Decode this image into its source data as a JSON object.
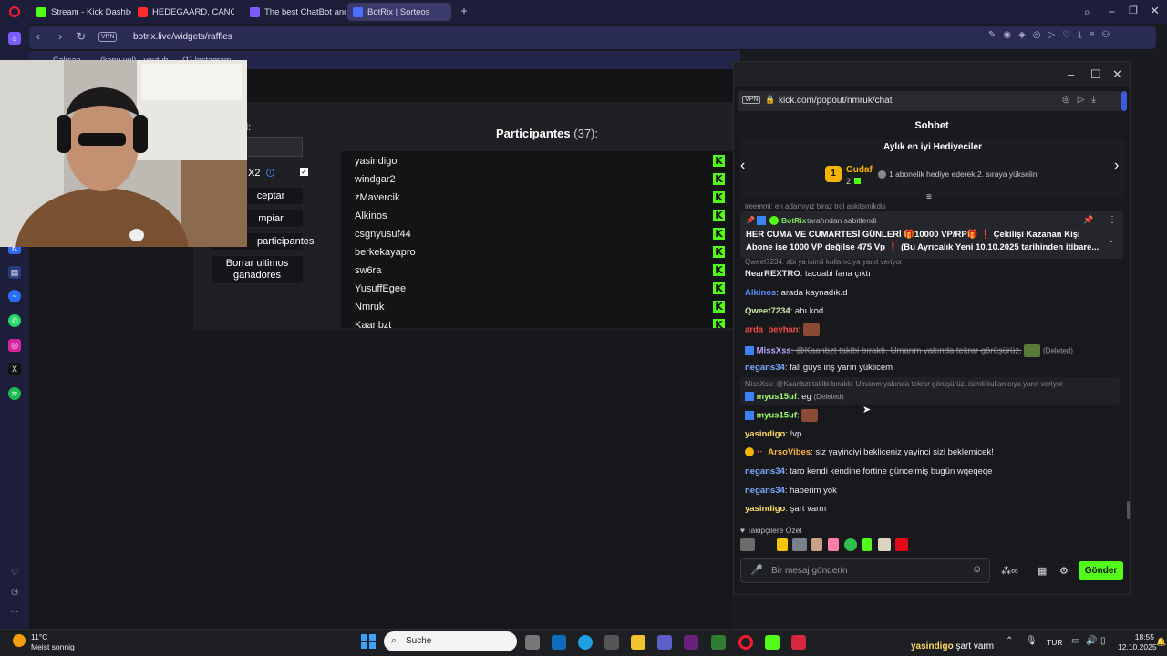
{
  "browser": {
    "tabs": [
      {
        "label": "Stream - Kick Dashboard",
        "color": "#53fc18"
      },
      {
        "label": "HEDEGAARD, CANCUN?, I",
        "color": "#ff2d2d"
      },
      {
        "label": "The best ChatBot and Wi",
        "color": "#7a5cff"
      },
      {
        "label": "BotRix | Sorteos",
        "color": "#4c6fff"
      }
    ],
    "new_tab": "+",
    "url": "botrix.live/widgets/raffles",
    "vpn": "VPN",
    "bookmarks": [
      "Çalışan",
      "(kopu yol) - youtub",
      "(1) Instagram"
    ]
  },
  "raffle": {
    "field_label": "d:",
    "x2_label": "X2",
    "buttons": [
      "ceptar",
      "mpiar",
      "participantes",
      "Borrar ultimos ganadores"
    ],
    "title": "Participantes",
    "count": "(37):",
    "participants": [
      "yasindigo",
      "windgar2",
      "zMavercik",
      "Alkinos",
      "csgnyusuf44",
      "berkekayapro",
      "sw6ra",
      "YusuffEgee",
      "Nmruk",
      "Kaanbzt"
    ]
  },
  "chat": {
    "url": "kick.com/popout/nmruk/chat",
    "vpn": "VPN",
    "title": "Sohbet",
    "gifter_heading": "Aylık en iyi Hediyeciler",
    "gifter_rank": "1",
    "gifter_name": "Gudaf",
    "gifter_count": "2",
    "gifter_note": "1 abonelik hediye ederek 2. sıraya yükselin",
    "partial_top": "ireemmi: en adamıyız biraz trol askitsmikdis",
    "pinned_by": "BotRix",
    "pinned_by_suffix": "tarafından sabitlendi",
    "pinned_text_1": "HER CUMA VE CUMARTESİ GÜNLERİ 🎁10000 VP/RP🎁 ❗ Çekilişi Kazanan Kişi",
    "pinned_text_2": "Abone ise 1000 VP değilse 475 Vp ❗ (Bu Ayrıcalık Yeni 10.10.2025 tarihinden itibare...",
    "reply_partial": "Qweet7234: abi ya isimli kullanıcıya yanıt veriyor",
    "messages": [
      {
        "user": "NearREXTRO",
        "color": "#e8e8e8",
        "text": ": tacoabi fana çıktı"
      },
      {
        "user": "Alkinos",
        "color": "#5b8dff",
        "text": ": arada kaynadık.d"
      },
      {
        "user": "Qweet7234",
        "color": "#cfe8a8",
        "text": ": abı kod"
      },
      {
        "user": "arda_beyhan",
        "color": "#ff4b4b",
        "text": ":"
      },
      {
        "user": "MissXss",
        "color": "#b9a6ff",
        "text": ": @Kaanbzt takibi bıraktı. Umarım yakında tekrar görüşürüz.",
        "tag": "(Deleted)"
      },
      {
        "user": "negans34",
        "color": "#7fa8ff",
        "text": ": fall guys inş yarın yüklicem"
      },
      {
        "user": "myus15uf",
        "color": "#9dff6d",
        "text": ": eg",
        "tag": "(Deleted)",
        "reply": "MissXss: @Kaanbzt takibi bıraktı. Umarım yakında tekrar görüşürüz. isimli kullanıcıya yanıt veriyor"
      },
      {
        "user": "myus15uf",
        "color": "#9dff6d",
        "text": ":"
      },
      {
        "user": "yasindigo",
        "color": "#ffd966",
        "text": ": !vp"
      },
      {
        "user": "ArsoVibes",
        "color": "#ffb640",
        "text": ": siz yayinciyi bekliceniz yayinci sizi beklemicek!"
      },
      {
        "user": "negans34",
        "color": "#7fa8ff",
        "text": ": taro kendi kendine fortine güncelmiş bugün wqeqeqe"
      },
      {
        "user": "negans34",
        "color": "#7fa8ff",
        "text": ": haberim yok"
      },
      {
        "user": "yasindigo",
        "color": "#ffd966",
        "text": ": şart varm"
      }
    ],
    "followers_label": "Takipçilere Özel",
    "input_placeholder": "Bir mesaj gönderin",
    "send_label": "Gönder"
  },
  "taskbar": {
    "weather_temp": "11°C",
    "weather_desc": "Meist sonnig",
    "search": "Suche",
    "ticker_user": "yasindigo",
    "ticker_text": "şart varm",
    "lang": "TUR",
    "time": "18:55",
    "date": "12.10.2025"
  }
}
